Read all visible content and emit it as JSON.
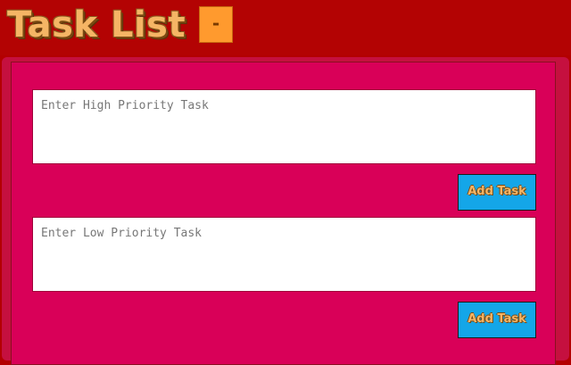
{
  "header": {
    "title": "Task List",
    "collapse_label": "-"
  },
  "high_priority": {
    "placeholder": "Enter High Priority Task",
    "value": "",
    "add_label": "Add Task"
  },
  "low_priority": {
    "placeholder": "Enter Low Priority Task",
    "value": "",
    "add_label": "Add Task"
  },
  "colors": {
    "header_bg": "#b30303",
    "panel_bg": "#d90058",
    "button_bg": "#14a6e8",
    "collapse_bg": "#ff9a2e",
    "title_color": "#f5b565"
  }
}
